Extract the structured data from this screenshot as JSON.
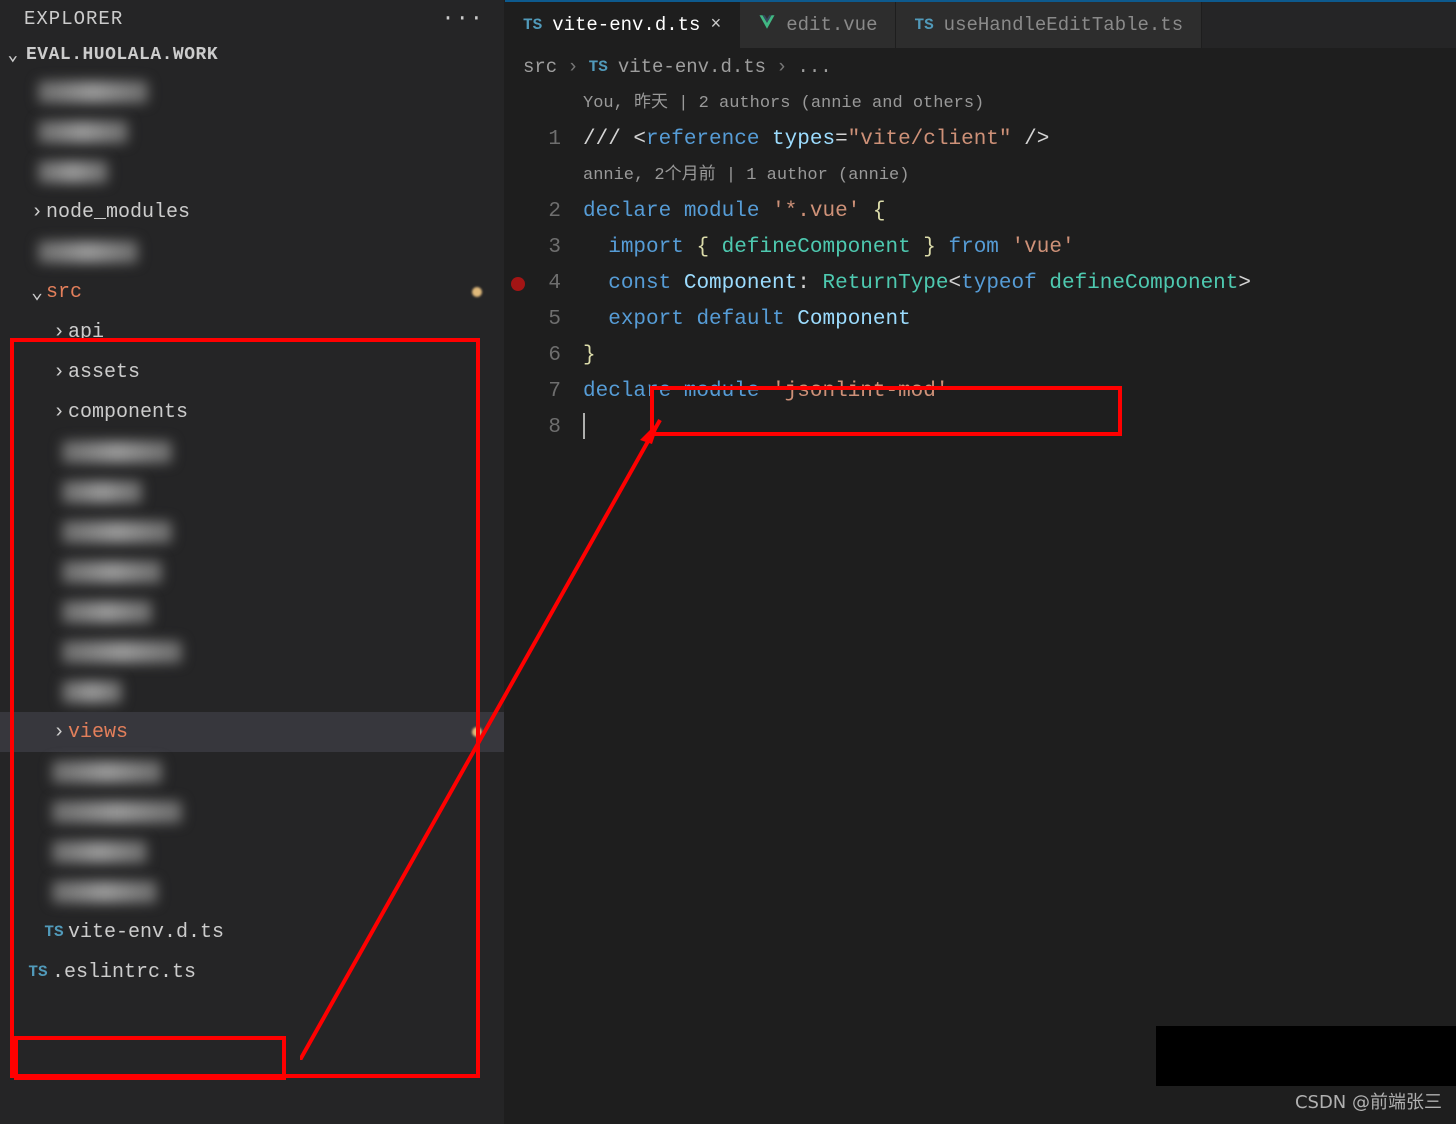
{
  "explorer": {
    "title": "EXPLORER"
  },
  "project": {
    "name": "EVAL.HUOLALA.WORK"
  },
  "tree": {
    "node_modules": "node_modules",
    "src": "src",
    "api": "api",
    "assets": "assets",
    "components": "components",
    "views": "views",
    "vite_env": "vite-env.d.ts",
    "eslint": ".eslintrc.ts"
  },
  "tabs": {
    "t1": "vite-env.d.ts",
    "t2": "edit.vue",
    "t3": "useHandleEditTable.ts"
  },
  "breadcrumb": {
    "p1": "src",
    "p2": "vite-env.d.ts",
    "p3": "..."
  },
  "icons": {
    "ts": "TS"
  },
  "chevron": {
    "right": "›",
    "down": "⌄"
  },
  "code": {
    "annot1": "You, 昨天 | 2 authors (annie and others)",
    "annot2": "annie, 2个月前 | 1 author (annie)",
    "l1a": "/// <",
    "l1b": "reference",
    "l1c": "types",
    "l1d": "=",
    "l1e": "\"vite/client\"",
    "l1f": " />",
    "l2a": "declare",
    "l2b": "module",
    "l2c": "'*.vue'",
    "l2d": " {",
    "l3a": "import",
    "l3b": " { ",
    "l3c": "defineComponent",
    "l3d": " } ",
    "l3e": "from",
    "l3f": "'vue'",
    "l4a": "const",
    "l4b": "Component",
    "l4c": ": ",
    "l4d": "ReturnType",
    "l4e": "<",
    "l4f": "typeof",
    "l4g": "defineComponent",
    "l4h": ">",
    "l5a": "export",
    "l5b": "default",
    "l5c": "Component",
    "l6a": "}",
    "l7a": "declare",
    "l7b": "module",
    "l7c": "'jsonlint-mod'"
  },
  "lines": {
    "n1": "1",
    "n2": "2",
    "n3": "3",
    "n4": "4",
    "n5": "5",
    "n6": "6",
    "n7": "7",
    "n8": "8"
  },
  "watermark": "CSDN @前端张三"
}
